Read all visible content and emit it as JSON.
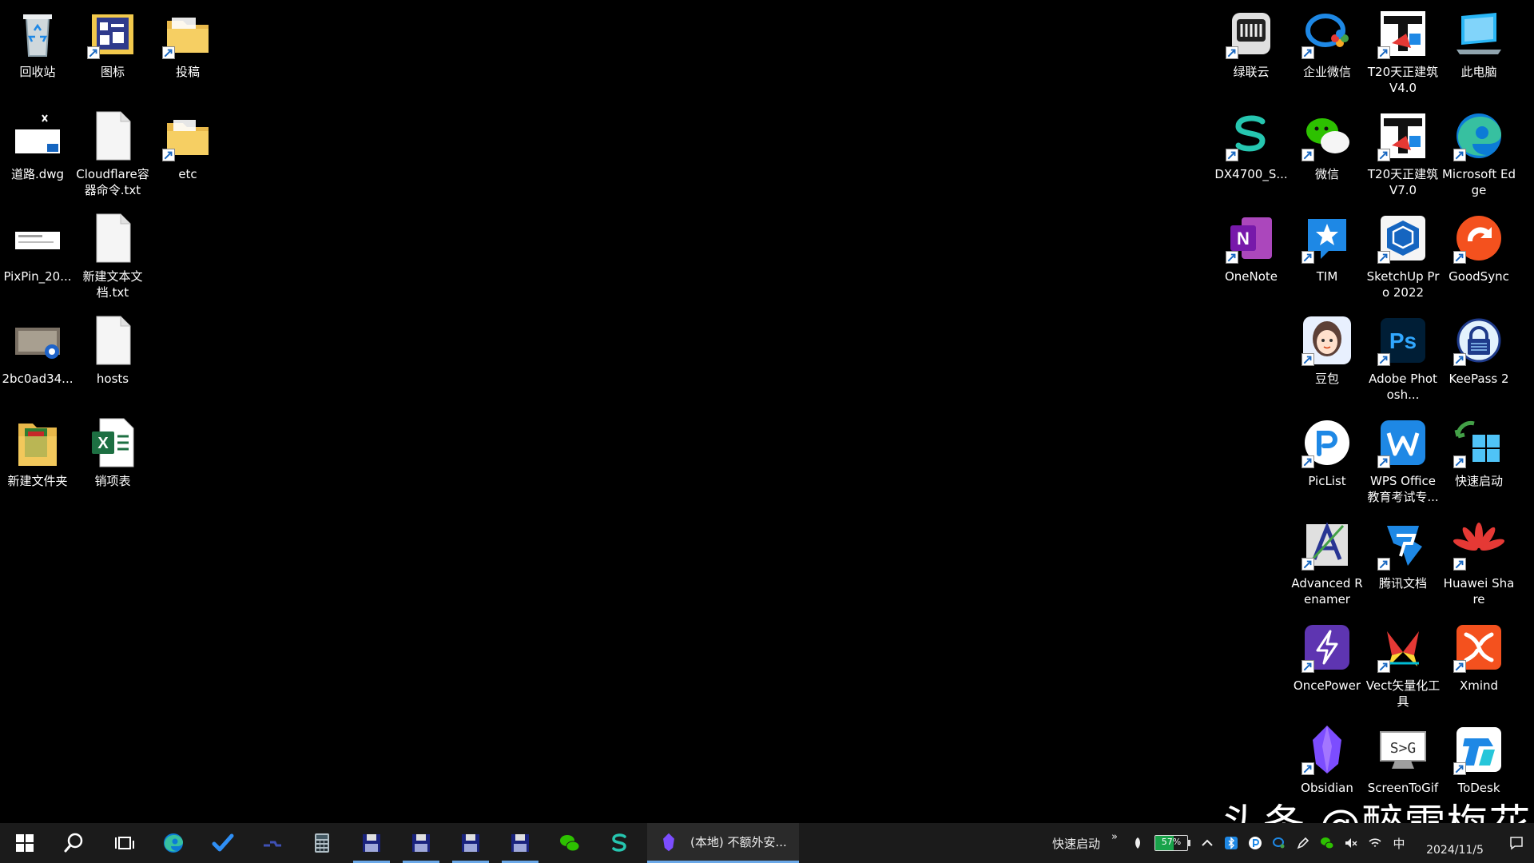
{
  "desktop": {
    "left_icons": [
      {
        "label": "回收站",
        "icon": "recycle-bin-icon"
      },
      {
        "label": "图标",
        "icon": "image-folder-icon"
      },
      {
        "label": "投稿",
        "icon": "folder-icon"
      },
      {
        "label": "道路.dwg",
        "icon": "dwg-file-icon"
      },
      {
        "label": "Cloudflare容器命令.txt",
        "icon": "text-file-icon"
      },
      {
        "label": "etc",
        "icon": "folder-icon"
      },
      {
        "label": "PixPin_20...",
        "icon": "image-file-icon"
      },
      {
        "label": "新建文本文档.txt",
        "icon": "text-file-icon"
      },
      {
        "label": "2bc0ad34...",
        "icon": "video-file-icon"
      },
      {
        "label": "hosts",
        "icon": "file-icon"
      },
      {
        "label": "新建文件夹",
        "icon": "folder-icon"
      },
      {
        "label": "销项表",
        "icon": "excel-file-icon"
      }
    ],
    "right_icons": [
      {
        "label": "绿联云",
        "icon": "ugreen-nas-icon"
      },
      {
        "label": "企业微信",
        "icon": "wecom-icon"
      },
      {
        "label": "T20天正建筑V4.0",
        "icon": "t20-icon"
      },
      {
        "label": "此电脑",
        "icon": "this-pc-icon"
      },
      {
        "label": "DX4700_S...",
        "icon": "s-logo-icon"
      },
      {
        "label": "微信",
        "icon": "wechat-icon"
      },
      {
        "label": "T20天正建筑V7.0",
        "icon": "t20-icon"
      },
      {
        "label": "Microsoft Edge",
        "icon": "edge-icon"
      },
      {
        "label": "OneNote",
        "icon": "onenote-icon"
      },
      {
        "label": "TIM",
        "icon": "tim-icon"
      },
      {
        "label": "SketchUp Pro 2022",
        "icon": "sketchup-icon"
      },
      {
        "label": "GoodSync",
        "icon": "goodsync-icon"
      },
      {
        "label": "豆包",
        "icon": "doubao-icon"
      },
      {
        "label": "Adobe Photosh...",
        "icon": "photoshop-icon"
      },
      {
        "label": "KeePass 2",
        "icon": "keepass-icon"
      },
      {
        "label": "PicList",
        "icon": "piclist-icon"
      },
      {
        "label": "WPS Office 教育考试专...",
        "icon": "wps-icon"
      },
      {
        "label": "快速启动",
        "icon": "quick-launch-icon"
      },
      {
        "label": "Advanced Renamer",
        "icon": "advanced-renamer-icon"
      },
      {
        "label": "腾讯文档",
        "icon": "tencent-docs-icon"
      },
      {
        "label": "Huawei Share",
        "icon": "huawei-icon"
      },
      {
        "label": "OncePower",
        "icon": "oncepower-icon"
      },
      {
        "label": "Vect矢量化工具",
        "icon": "vect-icon"
      },
      {
        "label": "Xmind",
        "icon": "xmind-icon"
      },
      {
        "label": "Obsidian",
        "icon": "obsidian-icon"
      },
      {
        "label": "ScreenToGif",
        "icon": "screentogif-icon"
      },
      {
        "label": "ToDesk",
        "icon": "todesk-icon"
      }
    ]
  },
  "watermark": "头条 @醉雪梅花",
  "taskbar": {
    "active_task_label": "(本地) 不额外安...",
    "quick_launch_label": "快速启动",
    "overflow_chevron": "»",
    "battery_percent": "57%",
    "battery_level": 0.57,
    "ime_label": "中",
    "date": "2024/11/5"
  },
  "colors": {
    "desktop_bg": "#000000",
    "taskbar_bg": "#1b1b1b",
    "accent": "#6aa8e8",
    "battery_fill": "#19a34a"
  }
}
